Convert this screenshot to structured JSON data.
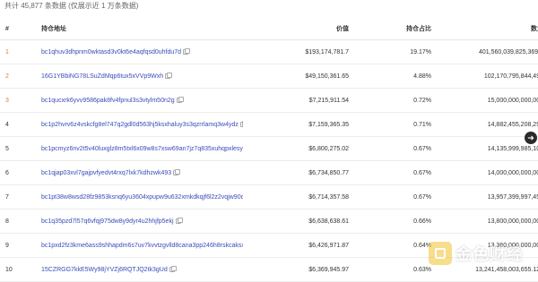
{
  "summary": "共计 45,877 条数据 (仅展示近 1 万条数据)",
  "columns": {
    "rank": "#",
    "address": "持仓地址",
    "value": "价值",
    "percent": "持仓占比",
    "quantity": "数量"
  },
  "rows": [
    {
      "rank": "1",
      "address": "bc1qhuv3dhpnm0wktasd3v0kt6e4aqfqsd0uhfdu7d",
      "value": "$193,174,781.7",
      "percent": "19.17%",
      "quantity": "401,560,039,825,369.2"
    },
    {
      "rank": "2",
      "address": "16G1YBbiNG78LSuZdMqp6tux5xVVp9Wxh",
      "value": "$49,150,361.65",
      "percent": "4.88%",
      "quantity": "102,170,795,844,498"
    },
    {
      "rank": "3",
      "address": "bc1qucxrk6yvv9586pak8fv4fpnul3s3vtylm50n2g",
      "value": "$7,215,911.54",
      "percent": "0.72%",
      "quantity": "15,000,000,000,000"
    },
    {
      "rank": "4",
      "address": "bc1p2hvrv6z4vskcfg8el747q2gdl0d563hj5ksxhaluy3s3qzrrlamq3w4ydz",
      "value": "$7,159,365.35",
      "percent": "0.71%",
      "quantity": "14,882,455,208,295"
    },
    {
      "rank": "5",
      "address": "bc1pcmyz6nv2t5v40luxglz8m5txl6x09w8s7xsw69an7jz7q835xuhqpxlesy",
      "value": "$6,800,275.02",
      "percent": "0.67%",
      "quantity": "14,135,999,985,108"
    },
    {
      "rank": "6",
      "address": "bc1qjap03xvl7gajpvfyedvt4rxq7lxk7kdhzwk493",
      "value": "$6,734,850.77",
      "percent": "0.67%",
      "quantity": "14,000,000,000,000"
    },
    {
      "rank": "7",
      "address": "bc1pt38w8wsd28fz9853ksnq6yu3604xpupw9u632xmkdkqjf6l2z2vqjw90dx",
      "value": "$6,714,357.58",
      "percent": "0.67%",
      "quantity": "13,957,399,997,450"
    },
    {
      "rank": "8",
      "address": "bc1q35pzd7l57q6vfqj975dw8y9dyr4u2hhjfp5ekj",
      "value": "$6,638,638.61",
      "percent": "0.66%",
      "quantity": "13,800,000,000,000"
    },
    {
      "rank": "9",
      "address": "bc1pxd2fz3kme6ass9shhapdm6s7uv7kvvtzgvlld8cana3pp246h8rskcaksx",
      "value": "$6,426,971.87",
      "percent": "0.64%",
      "quantity": "13,360,000,000,000"
    },
    {
      "rank": "10",
      "address": "15CZRGG7kkE5Wy98jYVZj6RQTJQ2tk3gUd",
      "value": "$6,369,945.97",
      "percent": "0.63%",
      "quantity": "13,241,458,003,655.125"
    }
  ],
  "icons": {
    "copy": "copy-icon",
    "scroll": "arrow-right-icon"
  },
  "watermark": "金色财经",
  "colors": {
    "address_link": "#3b4bb8",
    "rank_top": "#d9822b"
  }
}
